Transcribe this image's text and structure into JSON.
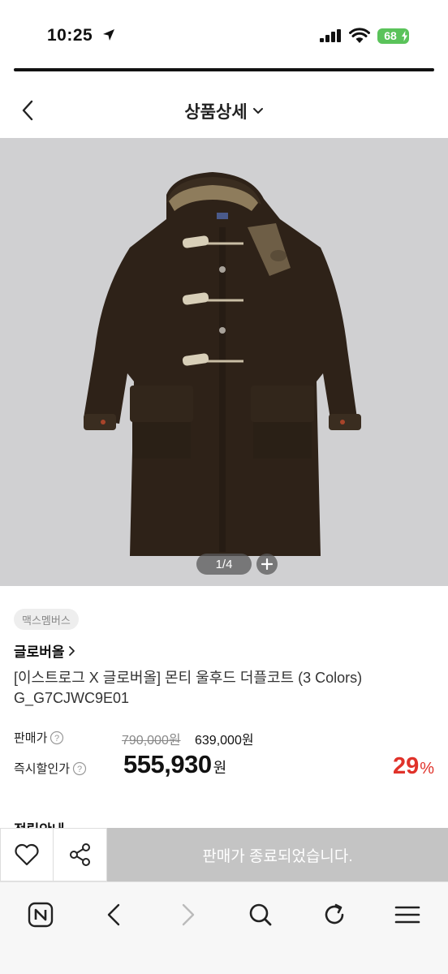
{
  "status_bar": {
    "time": "10:25",
    "battery": "68"
  },
  "header": {
    "title": "상품상세"
  },
  "gallery": {
    "counter": "1/4"
  },
  "product": {
    "member_badge": "맥스멤버스",
    "brand": "글로버올",
    "name": "[이스트로그 X 글로버올] 몬티 울후드 더플코트 (3 Colors)",
    "code": "G_G7CJWC9E01",
    "price_label": "판매가",
    "original_price": "790,000원",
    "sale_price": "639,000원",
    "instant_label": "즉시할인가",
    "instant_price": "555,930",
    "instant_unit": "원",
    "discount_value": "29",
    "discount_unit": "%",
    "next_section_heading": "적립안내"
  },
  "action_bar": {
    "soldout_label": "판매가 종료되었습니다."
  },
  "colors": {
    "discount": "#e0322a",
    "soldout_bg": "#c4c4c4",
    "battery": "#5ac35a",
    "image_bg": "#d0d0d2"
  },
  "icons": [
    "location-arrow-icon",
    "signal-icon",
    "wifi-icon",
    "battery-icon",
    "chevron-left-icon",
    "chevron-down-icon",
    "plus-icon",
    "chevron-right-icon",
    "help-icon",
    "heart-icon",
    "share-icon",
    "naver-home-icon",
    "back-arrow-icon",
    "forward-arrow-icon",
    "search-icon",
    "refresh-icon",
    "menu-icon"
  ]
}
